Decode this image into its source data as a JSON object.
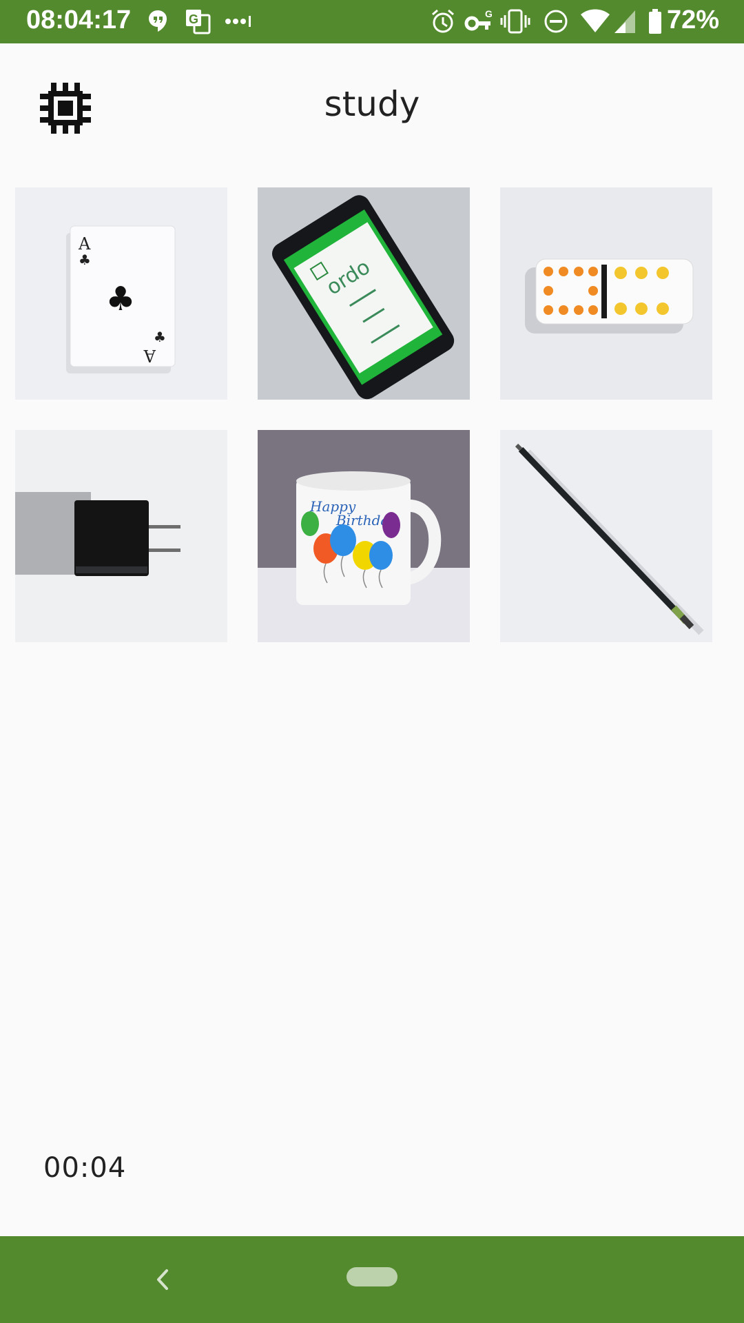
{
  "status_bar": {
    "time": "08:04:17",
    "battery": "72%",
    "icons": [
      "hangouts-icon",
      "translate-icon",
      "more-dots-icon",
      "alarm-icon",
      "vpn-key-icon",
      "vibrate-icon",
      "dnd-icon",
      "wifi-icon",
      "signal-icon",
      "battery-icon"
    ]
  },
  "header": {
    "title": "study",
    "logo_icon": "chip-icon"
  },
  "grid": {
    "items": [
      {
        "name": "playing-card-ace-of-clubs",
        "card_rank": "A"
      },
      {
        "name": "smartphone-ordo-app",
        "app_name": "ordo"
      },
      {
        "name": "domino-tile"
      },
      {
        "name": "power-adapter"
      },
      {
        "name": "birthday-mug",
        "mug_text_1": "Happy",
        "mug_text_2": "Birthday"
      },
      {
        "name": "pencil"
      }
    ]
  },
  "timer": {
    "value": "00:04"
  },
  "nav_bar": {
    "icons": [
      "back-icon",
      "home-pill"
    ]
  },
  "colors": {
    "accent": "#548a2e",
    "background": "#fafafa",
    "home_pill": "#bcd2ad"
  }
}
